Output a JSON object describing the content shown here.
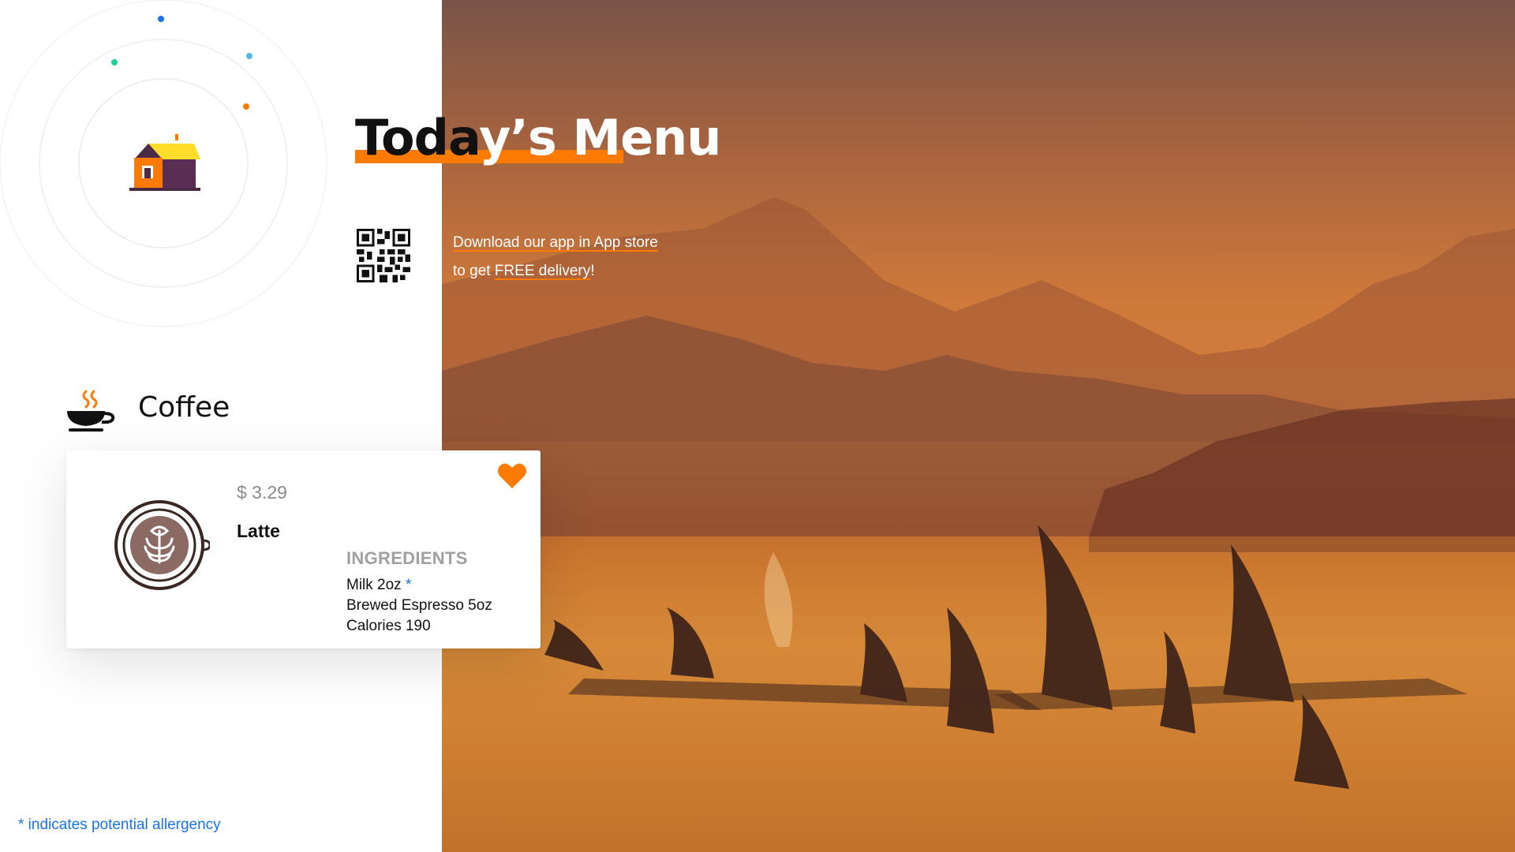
{
  "header": {
    "title": "Today’s Menu",
    "title_part_left": "Toda",
    "title_part_right": "y’s Menu"
  },
  "promo": {
    "line1": "Download our app in App store",
    "line2_prefix": "to get ",
    "line2_link": "FREE delivery",
    "line2_suffix": "!"
  },
  "category": {
    "label": "Coffee",
    "icon": "coffee-cup-icon"
  },
  "product": {
    "price": "$ 3.29",
    "name": "Latte",
    "icon": "latte-art-icon",
    "favorite": true,
    "ingredients_heading": "INGREDIENTS",
    "ingredients": [
      {
        "text": "Milk 2oz",
        "allergen_marker": "*"
      },
      {
        "text": "Brewed Espresso 5oz",
        "allergen_marker": ""
      },
      {
        "text": "Calories 190",
        "allergen_marker": ""
      }
    ]
  },
  "footnote": "* indicates potential allergency",
  "colors": {
    "accent": "#ff7a00",
    "allergen": "#1a73e8",
    "text": "#111111",
    "muted": "#8a8a8a"
  }
}
